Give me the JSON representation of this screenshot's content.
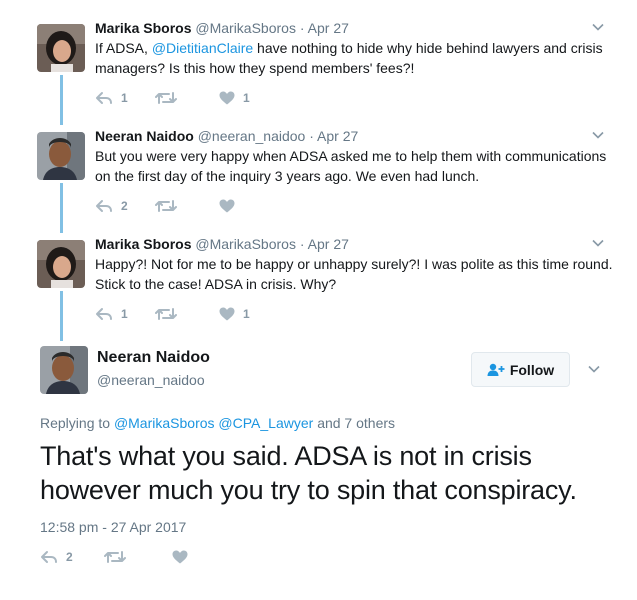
{
  "tweets": [
    {
      "name": "Marika Sboros",
      "handle": "@MarikaSboros",
      "dot": "·",
      "date": "Apr 27",
      "text_before": "If ADSA, ",
      "mention": "@DietitianClaire",
      "text_after": " have nothing to hide why hide behind lawyers and crisis managers? Is this how they spend members' fees?!",
      "reply_count": "1",
      "retweet_count": "",
      "like_count": "1"
    },
    {
      "name": "Neeran Naidoo",
      "handle": "@neeran_naidoo",
      "dot": "·",
      "date": "Apr 27",
      "text": "But you were very happy when ADSA asked me to help them with communications on the first day of the inquiry 3 years ago. We even had lunch.",
      "reply_count": "2",
      "retweet_count": "",
      "like_count": ""
    },
    {
      "name": "Marika Sboros",
      "handle": "@MarikaSboros",
      "dot": "·",
      "date": "Apr 27",
      "text": "Happy?! Not for me to be happy or unhappy surely?! I was polite as this time round. Stick to the case! ADSA in crisis. Why?",
      "reply_count": "1",
      "retweet_count": "",
      "like_count": "1"
    }
  ],
  "main": {
    "name": "Neeran Naidoo",
    "handle": "@neeran_naidoo",
    "follow_label": "Follow",
    "replying_prefix": "Replying to",
    "replying_user1": "@MarikaSboros",
    "replying_user2": "@CPA_Lawyer",
    "replying_suffix": "and 7 others",
    "text": "That's what you said. ADSA is not in crisis however much you try to spin that conspiracy.",
    "timestamp": "12:58 pm - 27 Apr 2017",
    "reply_count": "2",
    "retweet_count": "",
    "like_count": ""
  },
  "colors": {
    "link": "#1b95e0",
    "thread_line": "#81c0e4",
    "icon_gray": "#aab8c2",
    "meta_gray": "#657786"
  },
  "icons": [
    "reply-icon",
    "retweet-icon",
    "heart-icon",
    "chevron-down-icon",
    "follow-user-icon"
  ]
}
